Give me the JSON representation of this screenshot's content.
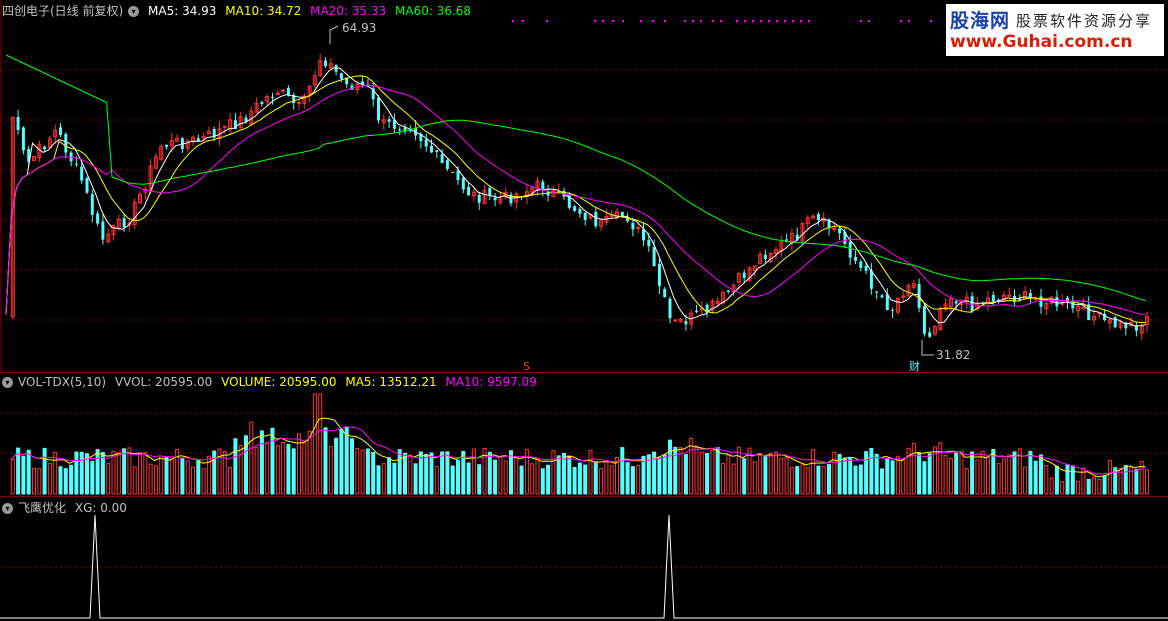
{
  "main_header": {
    "title": "四创电子(日线 前复权)",
    "ma5": "MA5: 34.93",
    "ma10": "MA10: 34.72",
    "ma20": "MA20: 35.33",
    "ma60": "MA60: 36.68"
  },
  "annotations": {
    "high_price": "64.93",
    "low_price": "31.82",
    "low_marker": "财",
    "mid_marker": "S"
  },
  "volume_header": {
    "name": "VOL-TDX(5,10)",
    "vvol": "VVOL: 20595.00",
    "volume": "VOLUME: 20595.00",
    "ma5": "MA5: 13512.21",
    "ma10": "MA10: 9597.09"
  },
  "indicator_header": {
    "name": "飞鹰优化",
    "xg": "XG: 0.00"
  },
  "logo": {
    "name": "股海网",
    "slogan": "股票软件资源分享",
    "url": "www.Guhai.com.cn"
  },
  "colors": {
    "up": "#ff3232",
    "down": "#54ffff",
    "ma5": "#ffffff",
    "ma10": "#ffff00",
    "ma20": "#ff00ff",
    "ma60": "#00ff00",
    "grid": "#8b0000",
    "indicator_line": "#ffffff"
  },
  "icons": {
    "collapse": "circle-chevron-icon"
  }
}
